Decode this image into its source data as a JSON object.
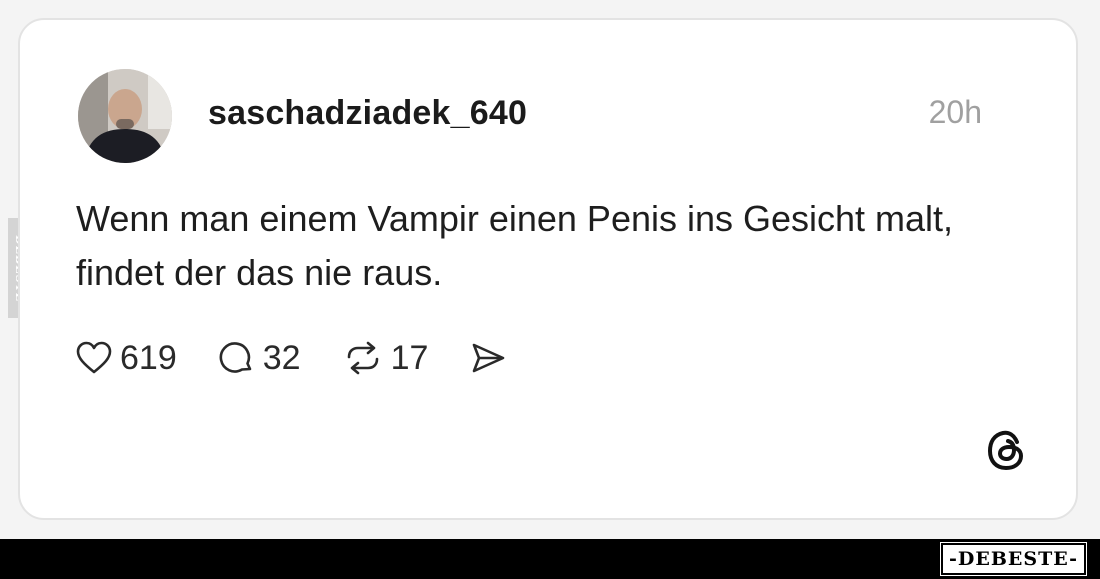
{
  "post": {
    "username": "saschadziadek_640",
    "time": "20h",
    "text": "Wenn man einem Vampir einen Penis ins Gesicht malt, findet der das nie raus.",
    "avatar_icon": "profile-photo"
  },
  "actions": {
    "likes": "619",
    "comments": "32",
    "reposts": "17",
    "like_icon": "heart-icon",
    "comment_icon": "comment-bubble-icon",
    "repost_icon": "repost-icon",
    "share_icon": "send-icon"
  },
  "branding": {
    "threads_icon": "threads-logo-icon",
    "side_watermark": "DEBESTE",
    "bottom_brand": "-DEBESTE-"
  },
  "colors": {
    "text": "#1e1e1e",
    "muted": "#a0a0a0",
    "card_border": "#e3e3e3",
    "bar": "#000000"
  }
}
